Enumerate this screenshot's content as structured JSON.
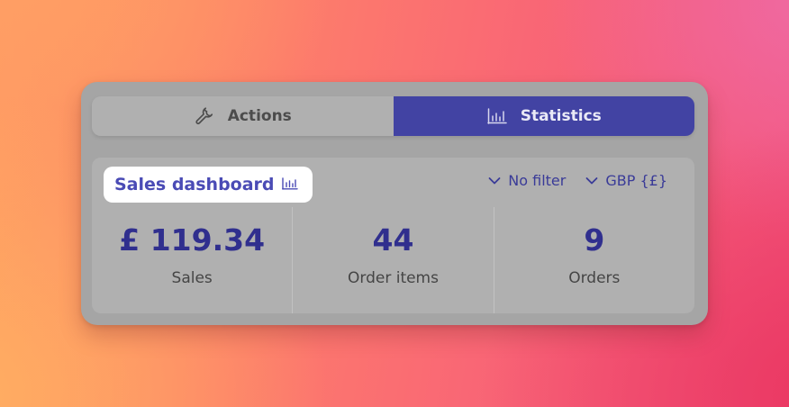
{
  "tabs": [
    {
      "label": "Actions",
      "icon": "wrench-icon",
      "active": false
    },
    {
      "label": "Statistics",
      "icon": "bar-chart-icon",
      "active": true
    }
  ],
  "dashboard": {
    "title": "Sales dashboard",
    "title_icon": "bar-chart-icon",
    "filters": [
      {
        "label": "No filter",
        "icon": "chevron-down-icon"
      },
      {
        "label": "GBP {£}",
        "icon": "chevron-down-icon"
      }
    ],
    "stats": [
      {
        "value": "£ 119.34",
        "label": "Sales"
      },
      {
        "value": "44",
        "label": "Order items"
      },
      {
        "value": "9",
        "label": "Orders"
      }
    ]
  },
  "colors": {
    "accent": "#4243a3",
    "value_text": "#302f8e",
    "panel_bg": "#a5a5a5",
    "card_bg": "#b0b0b0"
  }
}
